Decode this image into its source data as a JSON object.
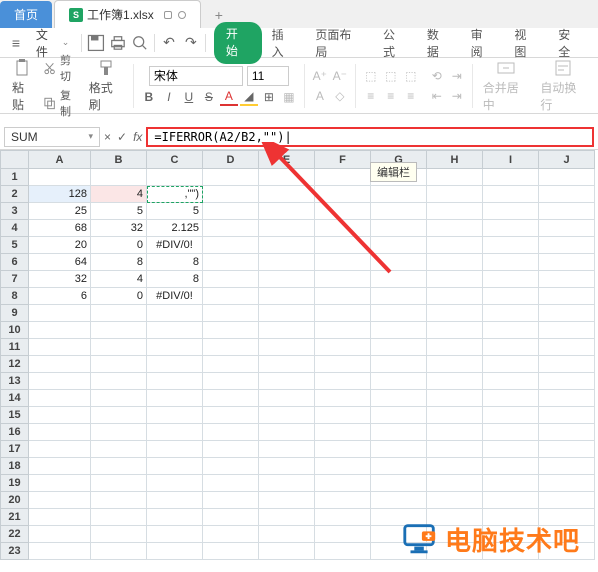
{
  "tabs": {
    "home": "首页",
    "file": "工作簿1.xlsx",
    "add": "+"
  },
  "fileMenu": {
    "menu": "≡",
    "label": "文件",
    "caret": "⌄"
  },
  "quick": {
    "save": "⎙",
    "undo": "↶",
    "redo": "↷",
    "print": "⎙",
    "search": "Ｑ"
  },
  "menuTabs": {
    "start": "开始",
    "insert": "插入",
    "layout": "页面布局",
    "formula": "公式",
    "data": "数据",
    "review": "审阅",
    "view": "视图",
    "security": "安全"
  },
  "ribbon": {
    "paste": "粘贴",
    "cut": "剪切",
    "copy": "复制",
    "fmtBrush": "格式刷",
    "font": "宋体",
    "size": "11",
    "B": "B",
    "I": "I",
    "U": "U",
    "S": "S",
    "A1": "A",
    "A2": "A",
    "alPlus": "A⁺",
    "alMinus": "A⁻",
    "merge": "合并居中",
    "wrap": "自动换行"
  },
  "fx": {
    "nameBox": "SUM",
    "cancel": "×",
    "enter": "✓",
    "fx": "fx",
    "formula": "=IFERROR(A2/B2,\"\")|"
  },
  "tooltip": "编辑栏",
  "cols": [
    "A",
    "B",
    "C",
    "D",
    "E",
    "F",
    "G",
    "H",
    "I",
    "J"
  ],
  "rowCount": 23,
  "cells": {
    "A2": "128",
    "B2": "4",
    "C2": ",\"\")",
    "A3": "25",
    "B3": "5",
    "C3": "5",
    "A4": "68",
    "B4": "32",
    "C4": "2.125",
    "A5": "20",
    "B5": "0",
    "C5": "#DIV/0!",
    "A6": "64",
    "B6": "8",
    "C6": "8",
    "A7": "32",
    "B7": "4",
    "C7": "8",
    "A8": "6",
    "B8": "0",
    "C8": "#DIV/0!"
  },
  "watermark": "电脑技术吧"
}
